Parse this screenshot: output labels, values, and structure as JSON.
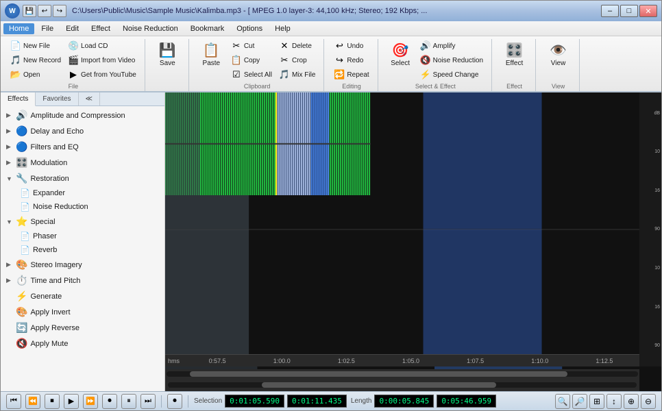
{
  "window": {
    "title": "C:\\Users\\Public\\Music\\Sample Music\\Kalimba.mp3 - [ MPEG 1.0 layer-3: 44,100 kHz; Stereo; 192 Kbps; ...",
    "logo_text": "W"
  },
  "titlebar_buttons": [
    "💾",
    "↩",
    "↪"
  ],
  "win_controls": [
    "–",
    "□",
    "✕"
  ],
  "menu": {
    "items": [
      "Home",
      "File",
      "Edit",
      "Effect",
      "Noise Reduction",
      "Bookmark",
      "Options",
      "Help"
    ]
  },
  "ribbon": {
    "groups": [
      {
        "label": "File",
        "items_large": [
          {
            "icon": "📄",
            "label": "New File",
            "type": "small"
          },
          {
            "icon": "🎵",
            "label": "New Record",
            "type": "small"
          },
          {
            "icon": "📂",
            "label": "Open",
            "type": "small"
          }
        ],
        "items_large2": [
          {
            "icon": "💿",
            "label": "Load CD",
            "type": "small"
          },
          {
            "icon": "🎬",
            "label": "Import from Video",
            "type": "small"
          },
          {
            "icon": "▶️",
            "label": "Get from YouTube",
            "type": "small"
          }
        ]
      },
      {
        "label": "Save",
        "items_large": [
          {
            "icon": "💾",
            "label": "Save",
            "type": "large"
          }
        ]
      },
      {
        "label": "Clipboard",
        "items_large": [
          {
            "icon": "📋",
            "label": "Paste",
            "type": "large"
          }
        ],
        "items_col": [
          {
            "icon": "✂️",
            "label": "Cut"
          },
          {
            "icon": "📋",
            "label": "Copy"
          },
          {
            "icon": "☑️",
            "label": "Select All"
          }
        ],
        "items_col2": [
          {
            "icon": "🗑️",
            "label": "Delete"
          },
          {
            "icon": "✂️",
            "label": "Crop"
          },
          {
            "icon": "🎵",
            "label": "Mix File"
          }
        ]
      },
      {
        "label": "Editing",
        "items_col": [
          {
            "icon": "↩",
            "label": "Undo"
          },
          {
            "icon": "↪",
            "label": "Redo"
          },
          {
            "icon": "🔁",
            "label": "Repeat"
          }
        ]
      },
      {
        "label": "Select & Effect",
        "items_large": [
          {
            "icon": "🎯",
            "label": "Select",
            "type": "large"
          }
        ],
        "items_col": [
          {
            "icon": "🔊",
            "label": "Amplify"
          },
          {
            "icon": "🔇",
            "label": "Noise Reduction"
          },
          {
            "icon": "⚡",
            "label": "Speed Change"
          }
        ]
      },
      {
        "label": "Effect",
        "items_large": [
          {
            "icon": "🎛️",
            "label": "Effect",
            "type": "large"
          }
        ]
      },
      {
        "label": "View",
        "items_large": [
          {
            "icon": "👁️",
            "label": "View",
            "type": "large"
          }
        ]
      }
    ]
  },
  "sidebar": {
    "tabs": [
      "Effects",
      "Favorites",
      "≪"
    ],
    "tree": [
      {
        "label": "Amplitude and Compression",
        "icon": "🔊",
        "type": "category",
        "expanded": false
      },
      {
        "label": "Delay and Echo",
        "icon": "🔵",
        "type": "category",
        "expanded": false
      },
      {
        "label": "Filters and EQ",
        "icon": "🔵",
        "type": "category",
        "expanded": false
      },
      {
        "label": "Modulation",
        "icon": "🎛️",
        "type": "category",
        "expanded": false
      },
      {
        "label": "Restoration",
        "icon": "🔧",
        "type": "category",
        "expanded": true,
        "children": [
          {
            "label": "Expander",
            "icon": "📄"
          },
          {
            "label": "Noise Reduction",
            "icon": "📄"
          }
        ]
      },
      {
        "label": "Special",
        "icon": "⭐",
        "type": "category",
        "expanded": true,
        "children": [
          {
            "label": "Phaser",
            "icon": "📄"
          },
          {
            "label": "Reverb",
            "icon": "📄"
          }
        ]
      },
      {
        "label": "Stereo Imagery",
        "icon": "🎨",
        "type": "category",
        "expanded": false
      },
      {
        "label": "Time and Pitch",
        "icon": "⏱️",
        "type": "category",
        "expanded": false
      },
      {
        "label": "Generate",
        "icon": "⚡",
        "type": "category",
        "leaf": true
      },
      {
        "label": "Apply Invert",
        "icon": "🎨",
        "type": "category",
        "leaf": true
      },
      {
        "label": "Apply Reverse",
        "icon": "🔄",
        "type": "category",
        "leaf": true
      },
      {
        "label": "Apply Mute",
        "icon": "🔇",
        "type": "category",
        "leaf": true
      }
    ]
  },
  "waveform": {
    "time_markers": [
      "hms",
      "0:57.5",
      "1:00.0",
      "1:02.5",
      "1:05.0",
      "1:07.5",
      "1:10.0",
      "1:12.5"
    ],
    "db_labels_right": [
      "dB",
      "10",
      "16",
      "90",
      "10",
      "16",
      "90"
    ],
    "selection_start": "0:01:05.590",
    "selection_end": "0:01:11.435",
    "length": "0:00:05.845",
    "total": "0:05:46.959"
  },
  "status": {
    "transport_buttons": [
      "⏮",
      "⏪",
      "⏹",
      "▶",
      "⏩",
      "⏺",
      "⏸",
      "⏭"
    ],
    "record_btn": "⏺",
    "selection_label": "Selection",
    "selection_start": "0:01:05.590",
    "selection_end": "0:01:11.435",
    "length_label": "Length",
    "length_val": "0:00:05.845",
    "total_val": "0:05:46.959"
  }
}
